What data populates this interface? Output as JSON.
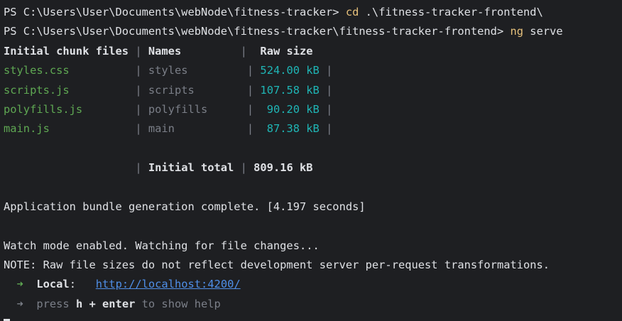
{
  "prompt1": {
    "path": "PS C:\\Users\\User\\Documents\\webNode\\fitness-tracker> ",
    "cmd": "cd",
    "args": " .\\fitness-tracker-frontend\\"
  },
  "prompt2": {
    "path": "PS C:\\Users\\User\\Documents\\webNode\\fitness-tracker\\fitness-tracker-frontend> ",
    "cmd": "ng",
    "args": " serve"
  },
  "table": {
    "header": {
      "file": "Initial chunk files",
      "sep1": " | ",
      "name": "Names",
      "sep2": "         |  ",
      "size": "Raw size"
    },
    "rows": [
      {
        "file": "styles.css         ",
        "sep1": " | ",
        "name": "styles        ",
        "sep2": " | ",
        "size": "524.00 kB",
        "end": " |"
      },
      {
        "file": "scripts.js         ",
        "sep1": " | ",
        "name": "scripts       ",
        "sep2": " | ",
        "size": "107.58 kB",
        "end": " |"
      },
      {
        "file": "polyfills.js       ",
        "sep1": " | ",
        "name": "polyfills     ",
        "sep2": " | ",
        "size": " 90.20 kB",
        "end": " |"
      },
      {
        "file": "main.js            ",
        "sep1": " | ",
        "name": "main          ",
        "sep2": " | ",
        "size": " 87.38 kB",
        "end": " |"
      }
    ],
    "total": {
      "pad": "                    | ",
      "label": "Initial total",
      "sep": " | ",
      "value": "809.16 kB"
    }
  },
  "messages": {
    "bundle": "Application bundle generation complete. [4.197 seconds]",
    "watch": "Watch mode enabled. Watching for file changes...",
    "note": "NOTE: Raw file sizes do not reflect development server per-request transformations."
  },
  "local": {
    "arrow": "  ➜  ",
    "label": "Local",
    "colon": ":   ",
    "url": "http://localhost:4200/"
  },
  "help": {
    "arrow": "  ➜  ",
    "press": "press ",
    "keys": "h + enter",
    "rest": " to show help"
  }
}
